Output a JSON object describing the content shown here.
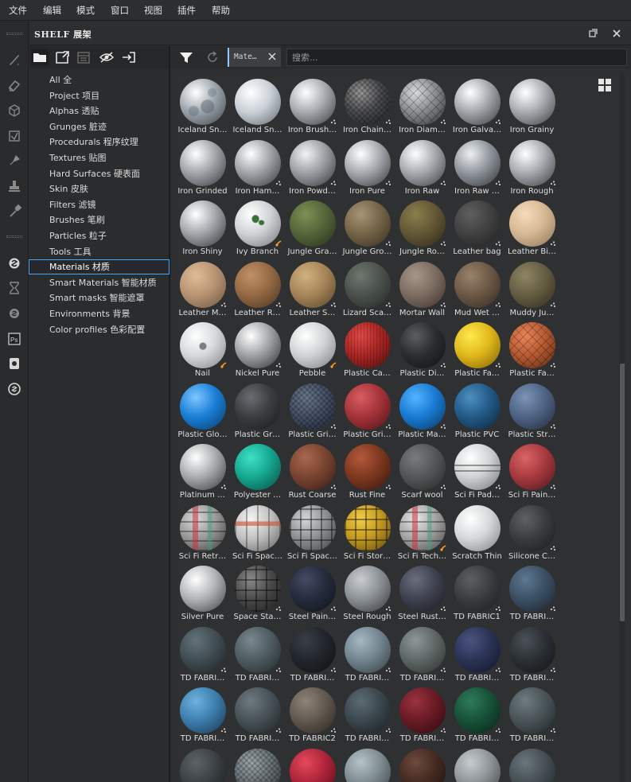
{
  "menubar": {
    "items": [
      "文件",
      "编辑",
      "模式",
      "窗口",
      "视图",
      "插件",
      "帮助"
    ]
  },
  "shelf": {
    "title": "SHELF 展架"
  },
  "categories": [
    {
      "label": "All 全"
    },
    {
      "label": "Project 项目"
    },
    {
      "label": "Alphas 透贴"
    },
    {
      "label": "Grunges 脏迹"
    },
    {
      "label": "Procedurals 程序纹理"
    },
    {
      "label": "Textures 贴图"
    },
    {
      "label": "Hard Surfaces 硬表面"
    },
    {
      "label": "Skin 皮肤"
    },
    {
      "label": "Filters 滤镜"
    },
    {
      "label": "Brushes 笔刷"
    },
    {
      "label": "Particles 粒子"
    },
    {
      "label": "Tools 工具"
    },
    {
      "label": "Materials 材质",
      "selected": true
    },
    {
      "label": "Smart Materials 智能材质"
    },
    {
      "label": "Smart masks 智能遮罩"
    },
    {
      "label": "Environments 背景"
    },
    {
      "label": "Color profiles 色彩配置"
    }
  ],
  "filter": {
    "tag": "Mate…",
    "search_placeholder": "搜索..."
  },
  "materials": [
    {
      "name": "Iceland Sn…",
      "c1": "#ffffff",
      "c2": "#9ea6ad",
      "c3": "#3c4248",
      "pat": "snow"
    },
    {
      "name": "Iceland Sn…",
      "c1": "#ffffff",
      "c2": "#c9d0d6",
      "c3": "#5f666c",
      "pat": "none"
    },
    {
      "name": "Iron Brush…",
      "c1": "#ffffff",
      "c2": "#a7abaf",
      "c3": "#35383b",
      "pat": "none"
    },
    {
      "name": "Iron Chain…",
      "c1": "#9a9a9a",
      "c2": "#4d4e50",
      "c3": "#1c1d1e",
      "pat": "mesh"
    },
    {
      "name": "Iron Diam…",
      "c1": "#d9dadb",
      "c2": "#8b8d8f",
      "c3": "#2d2e30",
      "pat": "diamond"
    },
    {
      "name": "Iron Galva…",
      "c1": "#ffffff",
      "c2": "#a2a6aa",
      "c3": "#34373a",
      "pat": "none"
    },
    {
      "name": "Iron Grainy",
      "c1": "#ffffff",
      "c2": "#a8acb0",
      "c3": "#383b3e",
      "pat": "none"
    },
    {
      "name": "Iron Grinded",
      "c1": "#ffffff",
      "c2": "#a0a4a8",
      "c3": "#33363a",
      "pat": "none"
    },
    {
      "name": "Iron Ham…",
      "c1": "#ffffff",
      "c2": "#9fa3a7",
      "c3": "#323538",
      "pat": "none"
    },
    {
      "name": "Iron Powd…",
      "c1": "#f2f3f4",
      "c2": "#9b9fa3",
      "c3": "#303336",
      "pat": "none"
    },
    {
      "name": "Iron Pure",
      "c1": "#ffffff",
      "c2": "#a4a8ac",
      "c3": "#323538",
      "pat": "none"
    },
    {
      "name": "Iron Raw",
      "c1": "#ffffff",
      "c2": "#a5a9ad",
      "c3": "#35383b",
      "pat": "none"
    },
    {
      "name": "Iron Raw …",
      "c1": "#eef0f2",
      "c2": "#8f959b",
      "c3": "#2e3236",
      "pat": "none"
    },
    {
      "name": "Iron Rough",
      "c1": "#ffffff",
      "c2": "#a6aaae",
      "c3": "#36393c",
      "pat": "none"
    },
    {
      "name": "Iron Shiny",
      "c1": "#ffffff",
      "c2": "#a2a6aa",
      "c3": "#2f3235",
      "pat": "none"
    },
    {
      "name": "Ivy Branch",
      "c1": "#ffffff",
      "c2": "#cfd3d6",
      "c3": "#6e7377",
      "pat": "leaf"
    },
    {
      "name": "Jungle Gra…",
      "c1": "#7e9055",
      "c2": "#55663a",
      "c3": "#262e1a",
      "pat": "none"
    },
    {
      "name": "Jungle Gro…",
      "c1": "#a89577",
      "c2": "#756548",
      "c3": "#352d20",
      "pat": "none"
    },
    {
      "name": "Jungle Ro…",
      "c1": "#8a7d4d",
      "c2": "#635835",
      "c3": "#2b2617",
      "pat": "none"
    },
    {
      "name": "Leather bag",
      "c1": "#5f5f5f",
      "c2": "#414141",
      "c3": "#1e1e1e",
      "pat": "none"
    },
    {
      "name": "Leather Bi…",
      "c1": "#f5dcbc",
      "c2": "#d6b893",
      "c3": "#8a7358",
      "pat": "none"
    },
    {
      "name": "Leather M…",
      "c1": "#e0bc97",
      "c2": "#b89473",
      "c3": "#6a533f",
      "pat": "none"
    },
    {
      "name": "Leather R…",
      "c1": "#c19166",
      "c2": "#946a44",
      "c3": "#4a321e",
      "pat": "none"
    },
    {
      "name": "Leather S…",
      "c1": "#d2b17f",
      "c2": "#a68559",
      "c3": "#54412a",
      "pat": "none"
    },
    {
      "name": "Lizard Sca…",
      "c1": "#6f776f",
      "c2": "#4b524c",
      "c3": "#222623",
      "pat": "none"
    },
    {
      "name": "Mortar Wall",
      "c1": "#a7968a",
      "c2": "#7d6c61",
      "c3": "#3a302a",
      "pat": "none"
    },
    {
      "name": "Mud Wet …",
      "c1": "#99826a",
      "c2": "#6c5946",
      "c3": "#30271e",
      "pat": "none"
    },
    {
      "name": "Muddy Ju…",
      "c1": "#8f8564",
      "c2": "#665e43",
      "c3": "#2d291d",
      "pat": "none"
    },
    {
      "name": "Nail",
      "c1": "#ffffff",
      "c2": "#d6d9db",
      "c3": "#7c8184",
      "pat": "dot"
    },
    {
      "name": "Nickel Pure",
      "c1": "#ffffff",
      "c2": "#9fa2a5",
      "c3": "#2c2e30",
      "pat": "none"
    },
    {
      "name": "Pebble",
      "c1": "#ffffff",
      "c2": "#d0d3d5",
      "c3": "#767b7e",
      "pat": "none"
    },
    {
      "name": "Plastic Ca…",
      "c1": "#e14a48",
      "c2": "#a92623",
      "c3": "#4d0f0e",
      "pat": "stripe"
    },
    {
      "name": "Plastic Di…",
      "c1": "#5c5e61",
      "c2": "#2c2d2f",
      "c3": "#0f1011",
      "pat": "none"
    },
    {
      "name": "Plastic Fa…",
      "c1": "#ffe94d",
      "c2": "#e0b81a",
      "c3": "#7a5d05",
      "pat": "none"
    },
    {
      "name": "Plastic Fa…",
      "c1": "#e8855a",
      "c2": "#b85b33",
      "c3": "#5a2a14",
      "pat": "diamond"
    },
    {
      "name": "Plastic Glo…",
      "c1": "#7fc7ff",
      "c2": "#1a7fd6",
      "c3": "#083a66",
      "pat": "none"
    },
    {
      "name": "Plastic Gr…",
      "c1": "#6a6d71",
      "c2": "#3b3d40",
      "c3": "#18191a",
      "pat": "none"
    },
    {
      "name": "Plastic Gri…",
      "c1": "#6c7a8c",
      "c2": "#48536a",
      "c3": "#1f2430",
      "pat": "mesh"
    },
    {
      "name": "Plastic Gri…",
      "c1": "#d85d5f",
      "c2": "#a5333a",
      "c3": "#4d1418",
      "pat": "none"
    },
    {
      "name": "Plastic Ma…",
      "c1": "#52b4ff",
      "c2": "#1a7bd4",
      "c3": "#07365f",
      "pat": "none"
    },
    {
      "name": "Plastic PVC",
      "c1": "#4c8fc2",
      "c2": "#235a87",
      "c3": "#0b2338",
      "pat": "none"
    },
    {
      "name": "Plastic Str…",
      "c1": "#7b93b5",
      "c2": "#4f6485",
      "c3": "#20293a",
      "pat": "none"
    },
    {
      "name": "Platinum …",
      "c1": "#ffffff",
      "c2": "#a8abae",
      "c3": "#333538",
      "pat": "none"
    },
    {
      "name": "Polyester …",
      "c1": "#3ee0c6",
      "c2": "#16a891",
      "c3": "#064a40",
      "pat": "none"
    },
    {
      "name": "Rust Coarse",
      "c1": "#a8684e",
      "c2": "#7a4431",
      "c3": "#361c14",
      "pat": "none"
    },
    {
      "name": "Rust Fine",
      "c1": "#b3593c",
      "c2": "#7e3820",
      "c3": "#38170c",
      "pat": "none"
    },
    {
      "name": "Scarf wool",
      "c1": "#7a7b7c",
      "c2": "#555657",
      "c3": "#252626",
      "pat": "none"
    },
    {
      "name": "Sci Fi Pad…",
      "c1": "#ffffff",
      "c2": "#cfd2d4",
      "c3": "#6f7376",
      "pat": "panel"
    },
    {
      "name": "Sci Fi Pain…",
      "c1": "#d96466",
      "c2": "#a83a3f",
      "c3": "#4a171b",
      "pat": "none"
    },
    {
      "name": "Sci Fi Retr…",
      "c1": "#d8d8d8",
      "c2": "#9a9a9a",
      "c3": "#3a3a3a",
      "pat": "scifi"
    },
    {
      "name": "Sci Fi Spac…",
      "c1": "#f4f4f4",
      "c2": "#c2c2c2",
      "c3": "#5e5e5e",
      "pat": "scifi2"
    },
    {
      "name": "Sci Fi Spac…",
      "c1": "#d6d7d8",
      "c2": "#8f9193",
      "c3": "#3a3b3c",
      "pat": "scifi3"
    },
    {
      "name": "Sci Fi Stor…",
      "c1": "#f1cc4a",
      "c2": "#c39a21",
      "c3": "#5a4410",
      "pat": "scifi3"
    },
    {
      "name": "Sci Fi Tech…",
      "c1": "#e8e8e8",
      "c2": "#a5a5a5",
      "c3": "#474747",
      "pat": "scifi"
    },
    {
      "name": "Scratch Thin",
      "c1": "#ffffff",
      "c2": "#d5d8da",
      "c3": "#7a7e81",
      "pat": "none"
    },
    {
      "name": "Silicone C…",
      "c1": "#5f6163",
      "c2": "#3b3c3e",
      "c3": "#18191a",
      "pat": "none"
    },
    {
      "name": "Silver Pure",
      "c1": "#ffffff",
      "c2": "#b1b3b5",
      "c3": "#3b3d3f",
      "pat": "none"
    },
    {
      "name": "Space Sta…",
      "c1": "#8a8a8a",
      "c2": "#4a4a4a",
      "c3": "#1c1c1c",
      "pat": "scifi3"
    },
    {
      "name": "Steel Pain…",
      "c1": "#434b64",
      "c2": "#262c3d",
      "c3": "#0e1119",
      "pat": "none"
    },
    {
      "name": "Steel Rough",
      "c1": "#c9cdd1",
      "c2": "#8c9196",
      "c3": "#34373a",
      "pat": "none"
    },
    {
      "name": "Steel Rust…",
      "c1": "#6b6f7d",
      "c2": "#3f4250",
      "c3": "#181a20",
      "pat": "none"
    },
    {
      "name": "TD FABRIC1",
      "c1": "#5c6063",
      "c2": "#3b3e40",
      "c3": "#1a1b1c",
      "pat": "none"
    },
    {
      "name": "TD FABRI…",
      "c1": "#5d7891",
      "c2": "#3c5064",
      "c3": "#19222b",
      "pat": "none"
    },
    {
      "name": "TD FABRI…",
      "c1": "#63737b",
      "c2": "#414d53",
      "c3": "#1b2023",
      "pat": "none"
    },
    {
      "name": "TD FABRI…",
      "c1": "#78898f",
      "c2": "#4f5c61",
      "c3": "#222729",
      "pat": "none"
    },
    {
      "name": "TD FABRI…",
      "c1": "#3a3f47",
      "c2": "#22262c",
      "c3": "#0d0f12",
      "pat": "none"
    },
    {
      "name": "TD FABRI…",
      "c1": "#a6b9c3",
      "c2": "#72848e",
      "c3": "#333c41",
      "pat": "none"
    },
    {
      "name": "TD FABRI…",
      "c1": "#8d9795",
      "c2": "#5f6866",
      "c3": "#282c2b",
      "pat": "none"
    },
    {
      "name": "TD FABRI…",
      "c1": "#4a5580",
      "c2": "#2b3356",
      "c3": "#111528",
      "pat": "none"
    },
    {
      "name": "TD FABRI…",
      "c1": "#4a5158",
      "c2": "#2b3035",
      "c3": "#111416",
      "pat": "none"
    },
    {
      "name": "TD FABRI…",
      "c1": "#6fb2de",
      "c2": "#3d7fae",
      "c3": "#17344a",
      "pat": "none"
    },
    {
      "name": "TD FABRI…",
      "c1": "#6e7b80",
      "c2": "#485257",
      "c3": "#1e2225",
      "pat": "none"
    },
    {
      "name": "TD FABRIC2",
      "c1": "#8e8378",
      "c2": "#625950",
      "c3": "#29241f",
      "pat": "none"
    },
    {
      "name": "TD FABRI…",
      "c1": "#5c6b73",
      "c2": "#3b474e",
      "c3": "#171d20",
      "pat": "none"
    },
    {
      "name": "TD FABRI…",
      "c1": "#9a3340",
      "c2": "#6a1b25",
      "c3": "#2c0a0f",
      "pat": "none"
    },
    {
      "name": "TD FABRI…",
      "c1": "#2f7a5a",
      "c2": "#175239",
      "c3": "#072217",
      "pat": "none"
    },
    {
      "name": "TD FABRI…",
      "c1": "#6f7b80",
      "c2": "#4a5458",
      "c3": "#1f2426",
      "pat": "none"
    },
    {
      "name": "",
      "c1": "#5d6468",
      "c2": "#3c4245",
      "c3": "#181b1c",
      "pat": "none"
    },
    {
      "name": "",
      "c1": "#9fa8ad",
      "c2": "#6f777c",
      "c3": "#2e3234",
      "pat": "mesh"
    },
    {
      "name": "",
      "c1": "#e34a5b",
      "c2": "#b0243a",
      "c3": "#500c18",
      "pat": "none"
    },
    {
      "name": "",
      "c1": "#b6c3c9",
      "c2": "#7f8c92",
      "c3": "#373e41",
      "pat": "none"
    },
    {
      "name": "",
      "c1": "#6d4a3e",
      "c2": "#452b22",
      "c3": "#1c100c",
      "pat": "none"
    },
    {
      "name": "",
      "c1": "#c7cccf",
      "c2": "#8f9598",
      "c3": "#3d4143",
      "pat": "none"
    },
    {
      "name": "",
      "c1": "#6b767b",
      "c2": "#465055",
      "c3": "#1e2325",
      "pat": "none"
    }
  ],
  "badges": [
    2,
    3,
    4,
    5,
    8,
    9,
    10,
    11,
    12,
    13,
    17,
    18,
    19,
    20,
    21,
    22,
    23,
    24,
    25,
    26,
    27,
    29,
    32,
    33,
    34,
    37,
    38,
    39,
    41,
    42,
    44,
    45,
    46,
    47,
    48,
    55,
    57,
    58,
    59,
    60,
    61,
    62,
    63,
    64,
    65,
    66,
    67,
    68,
    69,
    70,
    71,
    72,
    73,
    74,
    75,
    76
  ],
  "flask_badges": [
    15,
    28,
    30,
    53
  ],
  "colors": {
    "accent": "#4aa3ff",
    "badge": "#c8c8c8",
    "flask": "#ff9a1f"
  }
}
